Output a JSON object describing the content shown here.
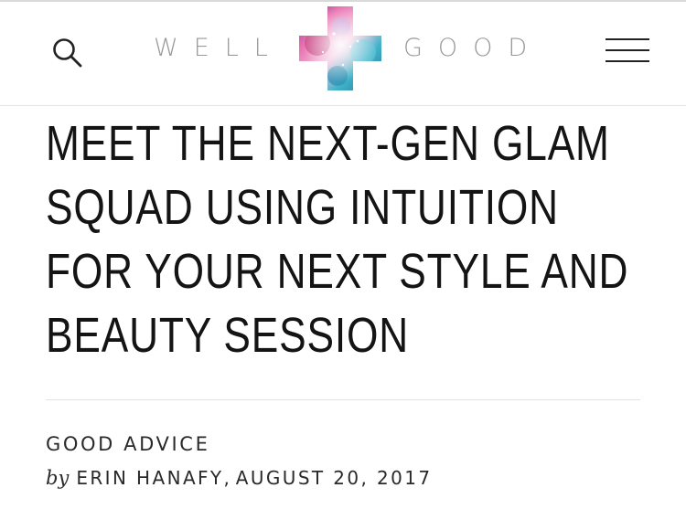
{
  "header": {
    "brand_left": "WELL",
    "brand_right": "GOOD",
    "search_icon": "search-icon",
    "menu_icon": "hamburger-menu-icon",
    "logo_icon": "cross-logo-icon"
  },
  "article": {
    "title": "MEET THE NEXT-GEN GLAM SQUAD USING INTUITION FOR YOUR NEXT STYLE AND BEAUTY SESSION",
    "category": "GOOD ADVICE",
    "by": "by",
    "author": "ERIN HANAFY",
    "separator": ",",
    "date": "AUGUST 20, 2017"
  },
  "colors": {
    "text": "#141414",
    "brand_gray": "#9a9a9a",
    "divider": "#e2e2e2",
    "cross_pink": "#e96fb0",
    "cross_teal": "#3fb3c9"
  }
}
